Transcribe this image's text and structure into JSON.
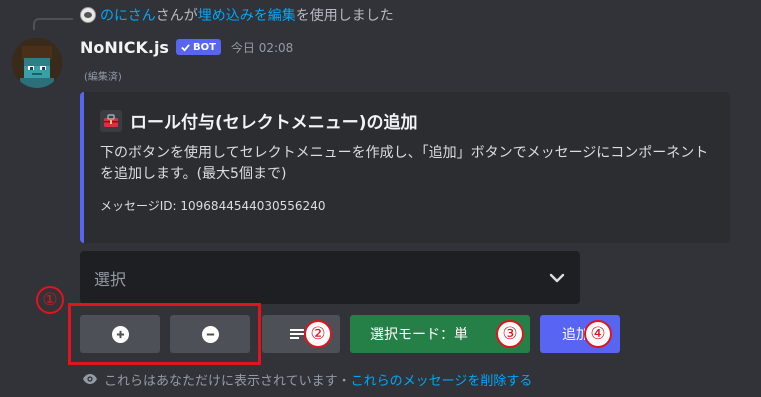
{
  "interaction": {
    "user": "のにさん",
    "text_mid": "さんが",
    "command": "埋め込みを編集",
    "text_end": "を使用しました"
  },
  "message": {
    "username": "NoNICK.js",
    "bot_tag": "BOT",
    "timestamp": "今日 02:08",
    "edited": "(編集済)"
  },
  "embed": {
    "accent_color": "#5865f2",
    "icon": "toolbox-icon",
    "title": "ロール付与(セレクトメニュー)の追加",
    "description": "下のボタンを使用してセレクトメニューを作成し、「追加」ボタンでメッセージにコンポーネントを追加します。(最大5個まで)",
    "footer": "メッセージID: 1096844544030556240"
  },
  "select_menu": {
    "placeholder": "選択"
  },
  "buttons": {
    "add_icon": "plus-circle-icon",
    "remove_icon": "minus-circle-icon",
    "list_icon": "list-icon",
    "mode_label": "選択モード：単",
    "add_label": "追加"
  },
  "markers": [
    "①",
    "②",
    "③",
    "④"
  ],
  "ephemeral": {
    "text": "これらはあなただけに表示されています・",
    "link": "これらのメッセージを削除する"
  }
}
